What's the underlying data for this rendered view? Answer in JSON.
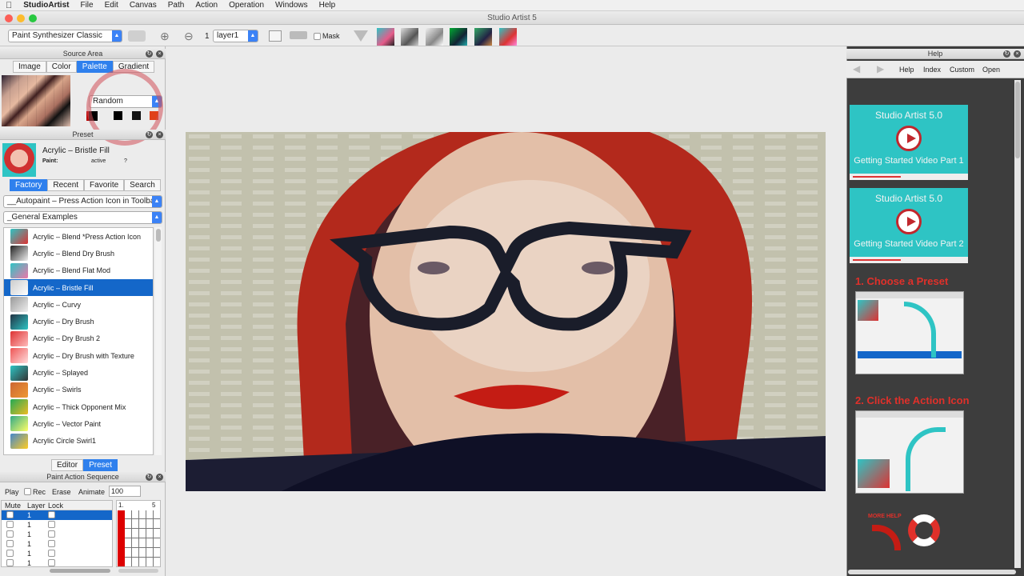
{
  "menubar": {
    "app": "StudioArtist",
    "items": [
      "File",
      "Edit",
      "Canvas",
      "Path",
      "Action",
      "Operation",
      "Windows",
      "Help"
    ]
  },
  "window": {
    "title": "Studio Artist 5"
  },
  "toolbar": {
    "preset_select": "Paint Synthesizer Classic",
    "layer_num": "1",
    "layer_select": "layer1",
    "mask_label": "Mask"
  },
  "source_area": {
    "title": "Source Area",
    "tabs": [
      "Image",
      "Color",
      "Palette",
      "Gradient"
    ],
    "active_tab": "Palette",
    "random_select": "Random"
  },
  "preset_panel": {
    "title": "Preset",
    "name": "Acrylic – Bristle Fill",
    "paint_label": "Paint:",
    "paint_value": "active",
    "paint_q": "?",
    "tabs": [
      "Factory",
      "Recent",
      "Favorite",
      "Search"
    ],
    "category1": "__Autopaint – Press Action Icon in Toolbar",
    "category2": "_General Examples",
    "items": [
      "Acrylic – Blend *Press Action Icon",
      "Acrylic – Blend Dry Brush",
      "Acrylic – Blend Flat Mod",
      "Acrylic – Bristle Fill",
      "Acrylic – Curvy",
      "Acrylic – Dry Brush",
      "Acrylic – Dry Brush 2",
      "Acrylic – Dry Brush with Texture",
      "Acrylic – Splayed",
      "Acrylic – Swirls",
      "Acrylic – Thick Opponent Mix",
      "Acrylic – Vector Paint",
      "Acrylic Circle  Swirl1"
    ],
    "selected_index": 3,
    "bottom_tabs": [
      "Editor",
      "Preset"
    ]
  },
  "pas": {
    "title": "Paint Action Sequence",
    "play": "Play",
    "rec": "Rec",
    "erase": "Erase",
    "animate": "Animate",
    "animate_value": "100",
    "col_mute": "Mute",
    "col_layer": "Layer",
    "col_lock": "Lock",
    "rows": [
      "1",
      "1",
      "1",
      "1",
      "1",
      "1"
    ],
    "timeline_start": "1.",
    "timeline_end": "5"
  },
  "help": {
    "title": "Help",
    "nav": [
      "Help",
      "Index",
      "Custom",
      "Open"
    ],
    "video1_title": "Studio Artist 5.0",
    "video1_sub": "Getting Started Video Part 1",
    "video2_title": "Studio Artist 5.0",
    "video2_sub": "Getting Started Video Part 2",
    "step1": "1.  Choose a Preset",
    "step2": "2.  Click the Action Icon",
    "more_help": "MORE HELP"
  },
  "colors": {
    "accent": "#2f80ed",
    "selected_row": "#1467c9",
    "help_bg": "#3d3d3d",
    "help_teal": "#2ec4c4",
    "help_red": "#e0302a"
  }
}
